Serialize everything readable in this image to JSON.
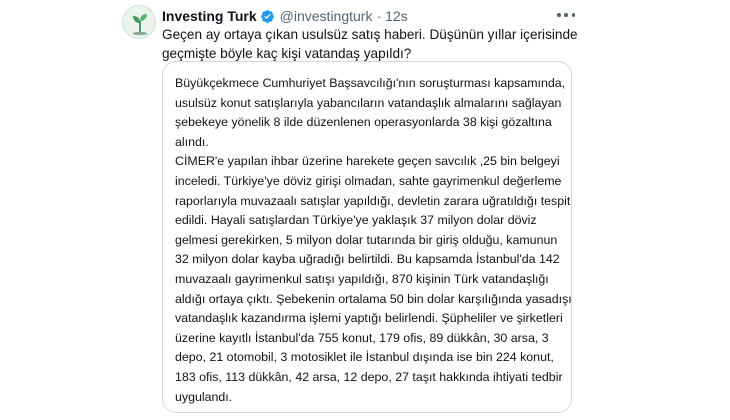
{
  "account": {
    "display_name": "Investing Turk",
    "handle": "@investingturk",
    "separator": "·",
    "time": "12s",
    "verified": true,
    "verified_color": "#1d9bf0",
    "avatar_icon": "plant-sprout-icon"
  },
  "tweet": {
    "lines": [
      "Geçen ay ortaya çıkan usulsüz satış haberi. Düşünün yıllar içerisinde",
      "geçmişte böyle kaç kişi vatandaş yapıldı?"
    ]
  },
  "quote": {
    "lines": [
      "Büyükçekmece Cumhuriyet Başsavcılığı'nın soruşturması kapsamında,",
      "usulsüz konut satışlarıyla yabancıların vatandaşlık almalarını sağlayan",
      "şebekeye yönelik 8 ilde düzenlenen operasyonlarda 38 kişi gözaltına",
      "alındı.",
      "CİMER'e yapılan ihbar üzerine harekete geçen savcılık ,25 bin belgeyi",
      "inceledi. Türkiye'ye döviz girişi olmadan, sahte gayrimenkul değerleme",
      "raporlarıyla muvazaalı satışlar yapıldığı, devletin zarara uğratıldığı tespit",
      "edildi. Hayali satışlardan Türkiye'ye yaklaşık 37 milyon dolar döviz",
      "gelmesi gerekirken, 5 milyon dolar tutarında bir giriş olduğu, kamunun",
      "32 milyon dolar kayba uğradığı belirtildi. Bu kapsamda İstanbul'da 142",
      "muvazaalı gayrimenkul satışı yapıldığı, 870 kişinin Türk vatandaşlığı",
      "aldığı ortaya çıktı. Şebekenin ortalama 50 bin dolar karşılığında yasadışı",
      "vatandaşlık kazandırma işlemi yaptığı belirlendi. Şüpheliler ve şirketleri",
      "üzerine kayıtlı İstanbul'da 755 konut, 179 ofis, 89 dükkân, 30 arsa, 3",
      "depo, 21 otomobil, 3 motosiklet ile İstanbul dışında ise bin 224 konut,",
      "183 ofis, 113 dükkân, 42 arsa, 12 depo, 27 taşıt hakkında ihtiyati tedbir",
      "uygulandı."
    ]
  },
  "icons": {
    "verified": "verified-badge-icon",
    "more": "more-options-icon"
  }
}
